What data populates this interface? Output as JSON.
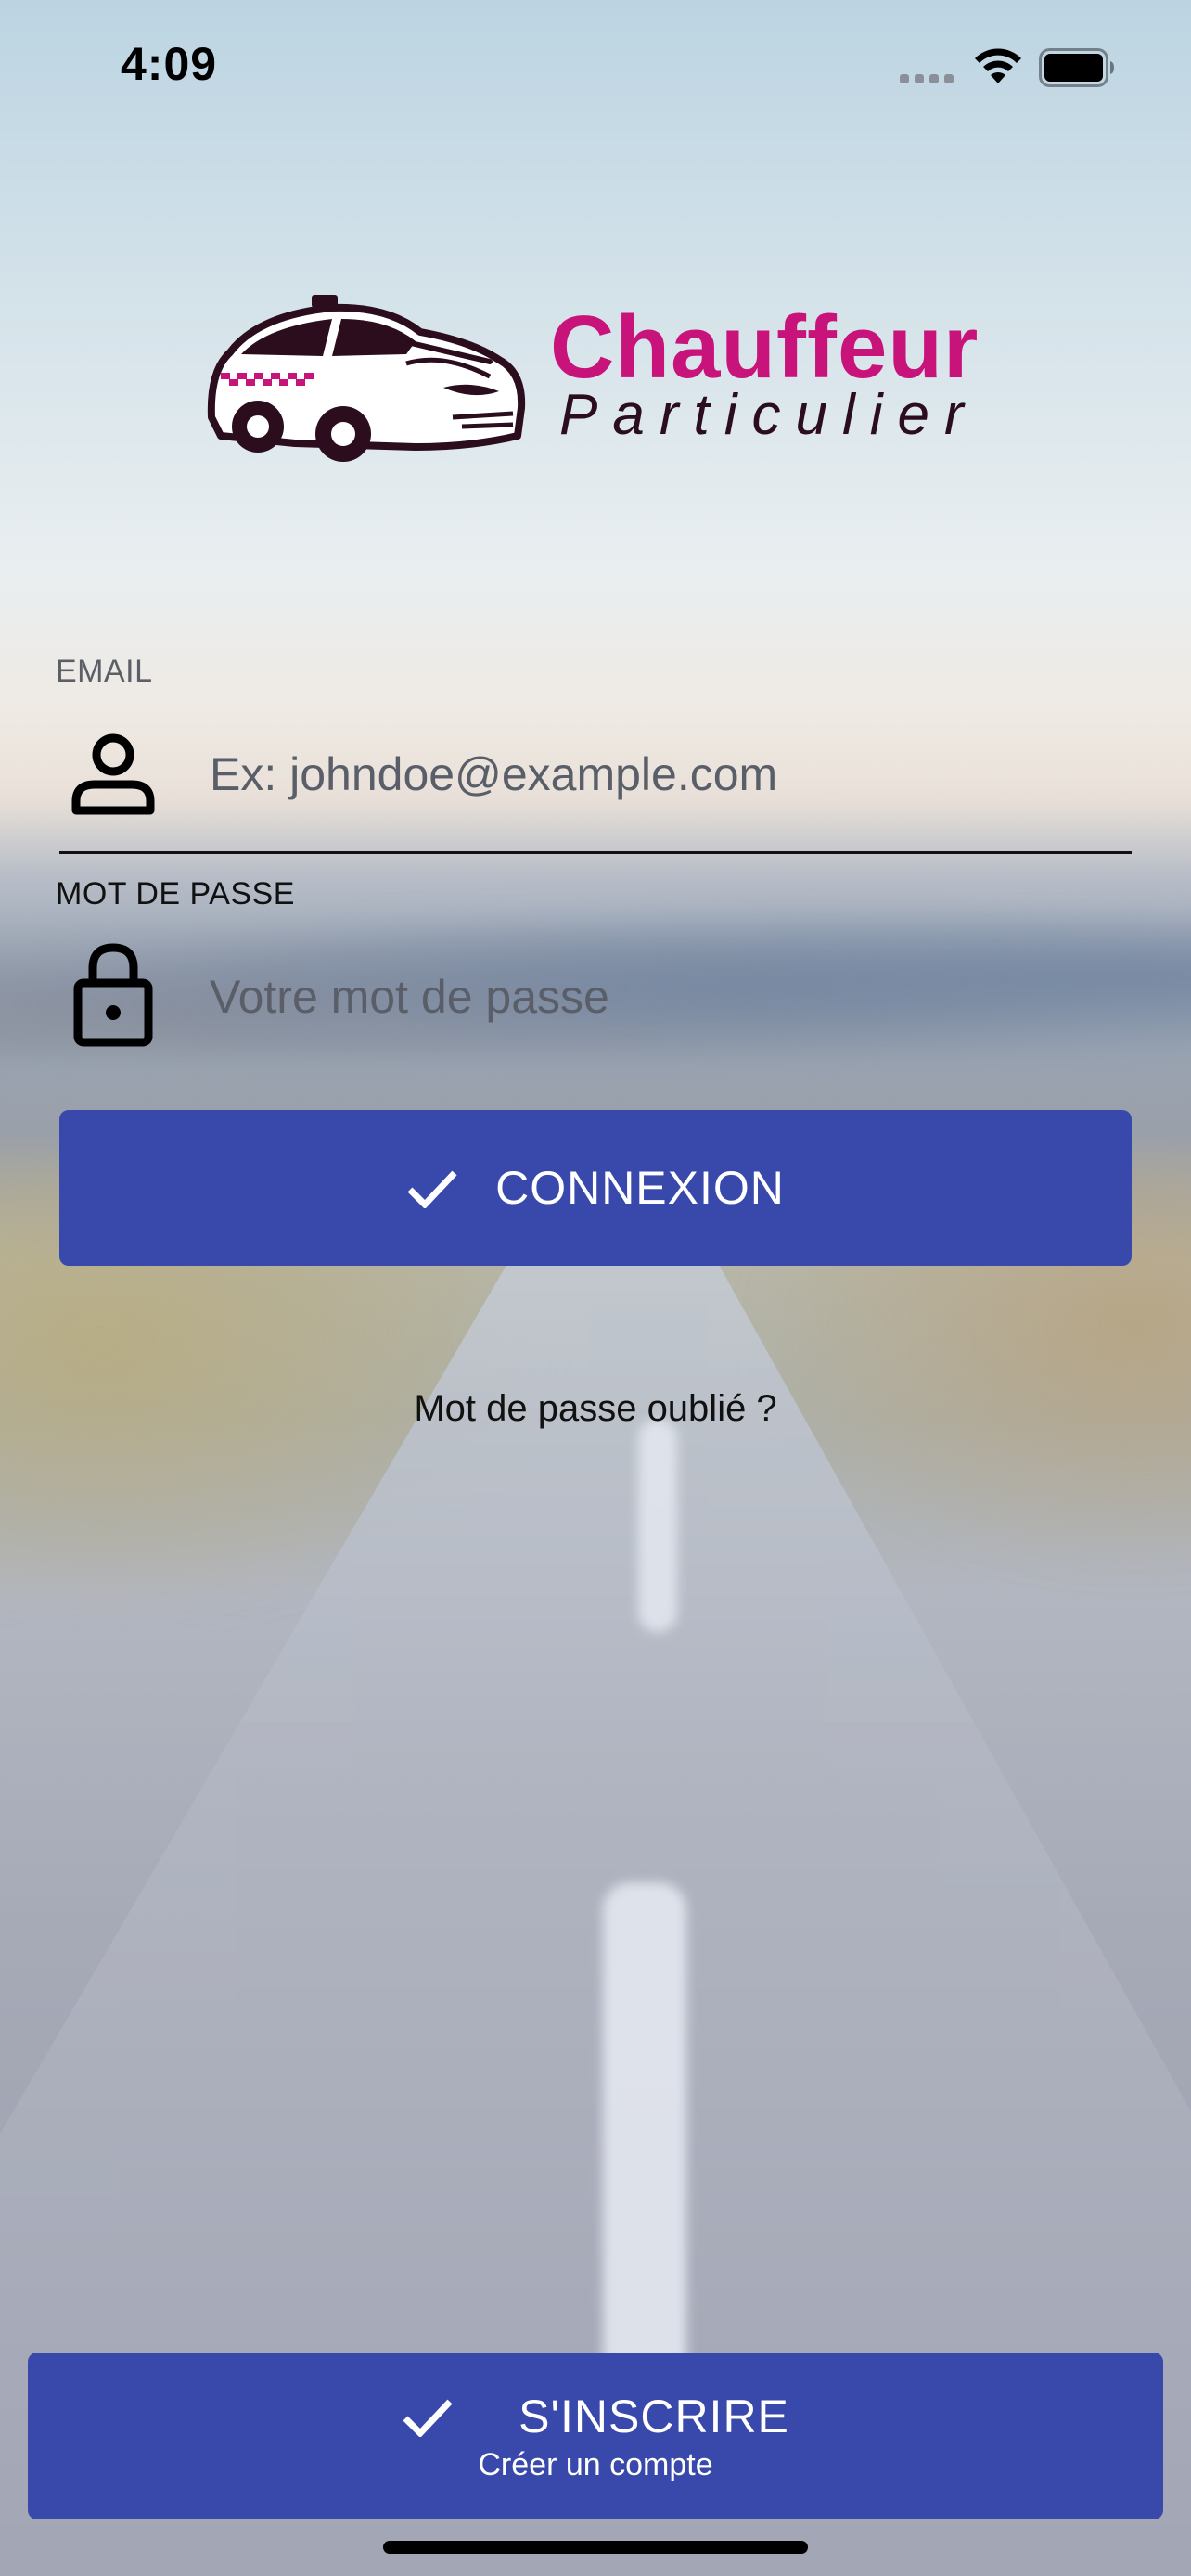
{
  "status_bar": {
    "time": "4:09",
    "icons": [
      "cellular-signal-icon",
      "wifi-icon",
      "battery-icon"
    ]
  },
  "logo": {
    "line1": "Chauffeur",
    "line2": "Particulier",
    "icon": "taxi-car-logo",
    "colors": {
      "brand_pink": "#c8137a",
      "brand_dark": "#2b0d1e"
    }
  },
  "form": {
    "email": {
      "label": "EMAIL",
      "placeholder": "Ex: johndoe@example.com",
      "value": "",
      "icon": "person-icon"
    },
    "password": {
      "label": "MOT DE PASSE",
      "placeholder": "Votre mot de passe",
      "value": "",
      "icon": "lock-icon"
    },
    "login_button": {
      "label": "CONNEXION",
      "icon": "check-icon"
    },
    "forgot_password": "Mot de passe oublié ?"
  },
  "signup_button": {
    "label": "S'INSCRIRE",
    "sublabel": "Créer un compte",
    "icon": "check-icon"
  },
  "theme": {
    "button_color": "#3949ab",
    "button_text": "#ffffff"
  }
}
